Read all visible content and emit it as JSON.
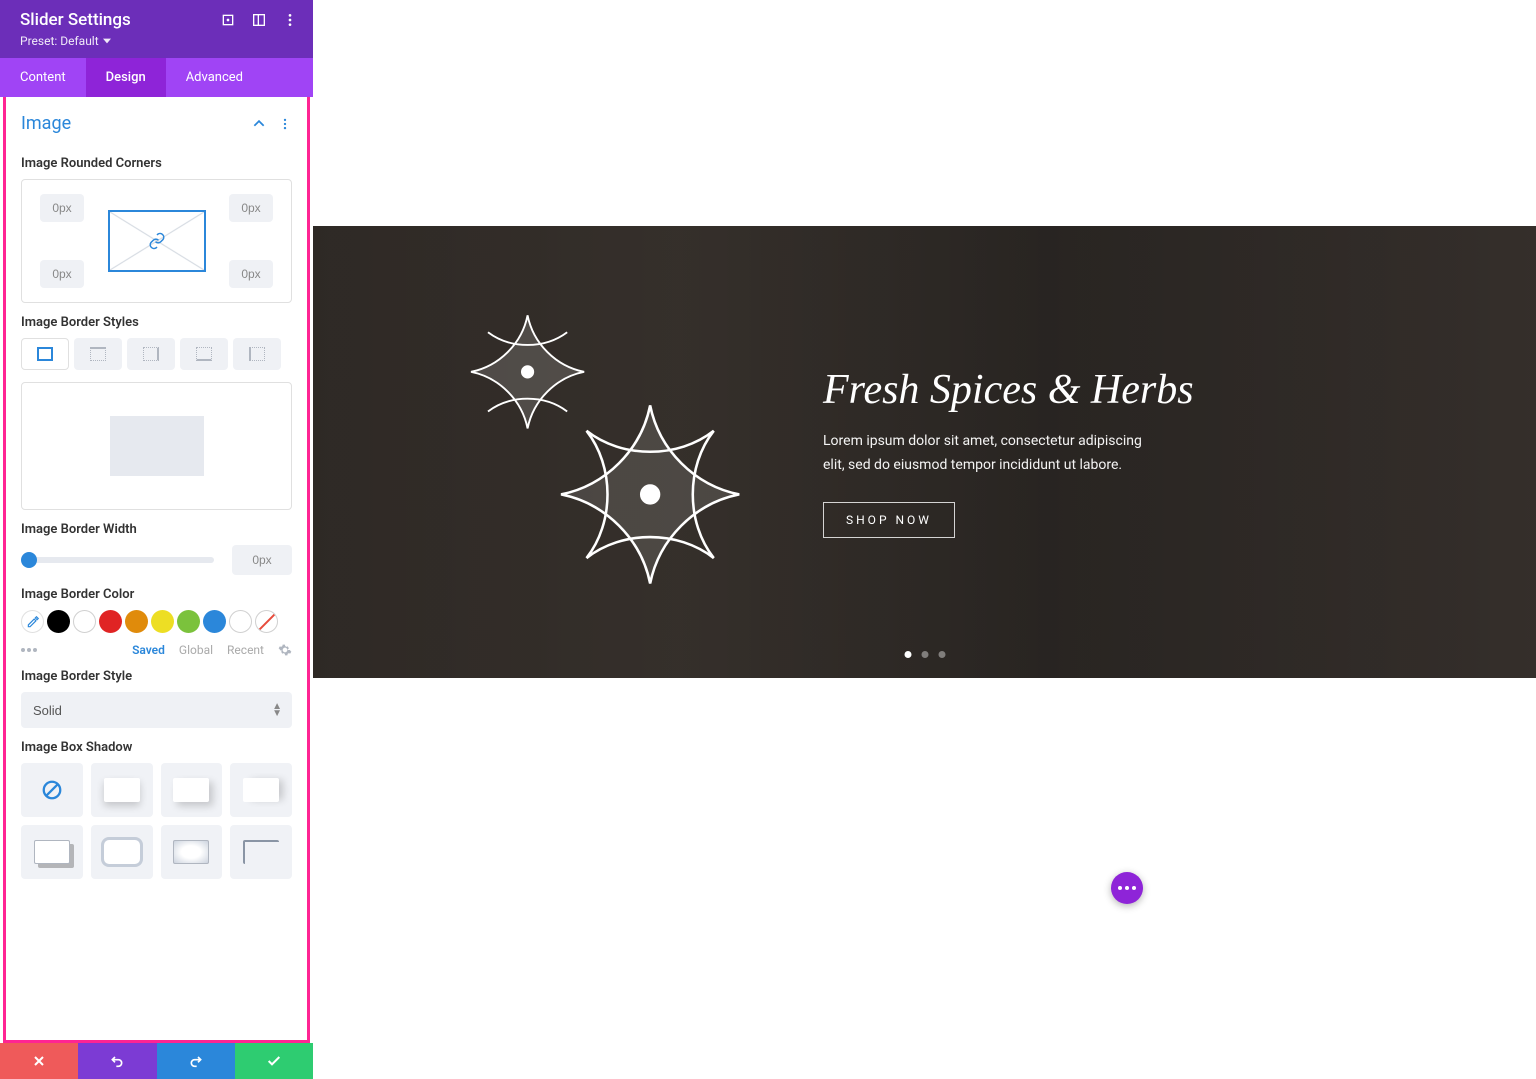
{
  "header": {
    "title": "Slider Settings",
    "preset": "Preset: Default"
  },
  "tabs": {
    "content": "Content",
    "design": "Design",
    "advanced": "Advanced"
  },
  "section": {
    "title": "Image"
  },
  "labels": {
    "rounded": "Image Rounded Corners",
    "borderStyles": "Image Border Styles",
    "borderWidth": "Image Border Width",
    "borderColor": "Image Border Color",
    "borderStyle": "Image Border Style",
    "boxShadow": "Image Box Shadow"
  },
  "corners": {
    "tl": "0px",
    "tr": "0px",
    "bl": "0px",
    "br": "0px"
  },
  "borderWidth": {
    "value": "0px"
  },
  "colorTabs": {
    "saved": "Saved",
    "global": "Global",
    "recent": "Recent"
  },
  "colors": {
    "black": "#000000",
    "white": "#ffffff",
    "red": "#e02424",
    "orange": "#e08b0b",
    "yellow": "#edde24",
    "green": "#7bc23c",
    "blue": "#2b87da",
    "white2": "#ffffff"
  },
  "borderStyle": {
    "value": "Solid"
  },
  "slide": {
    "title": "Fresh Spices & Herbs",
    "desc": "Lorem ipsum dolor sit amet, consectetur adipiscing elit, sed do eiusmod tempor incididunt ut labore.",
    "button": "SHOP NOW"
  }
}
